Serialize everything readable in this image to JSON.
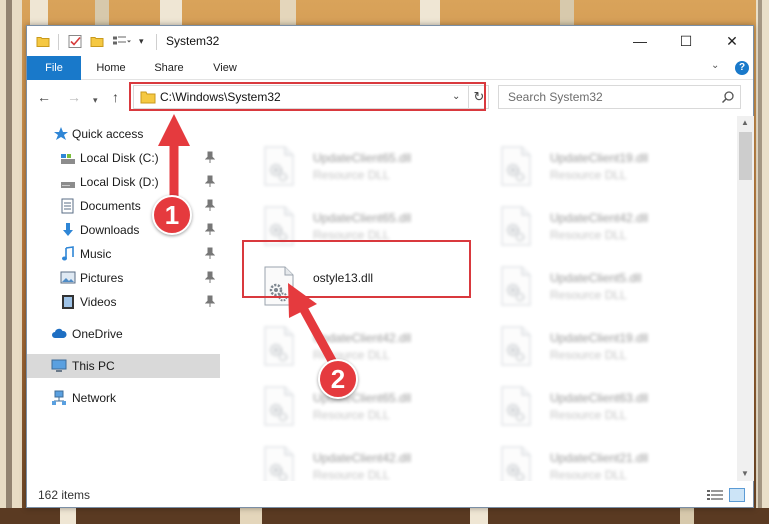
{
  "window": {
    "title": "System32",
    "minimize_glyph": "—",
    "maximize_glyph": "☐",
    "close_glyph": "✕"
  },
  "ribbon": {
    "tabs": [
      "File",
      "Home",
      "Share",
      "View"
    ],
    "help_glyph": "?"
  },
  "address": {
    "path": "C:\\Windows\\System32",
    "search_placeholder": "Search System32"
  },
  "nav_pane": {
    "items": [
      {
        "label": "Quick access",
        "icon": "star-icon"
      },
      {
        "label": "Local Disk (C:)",
        "icon": "drive-icon",
        "pinned": true
      },
      {
        "label": "Local Disk (D:)",
        "icon": "drive-icon",
        "pinned": true
      },
      {
        "label": "Documents",
        "icon": "documents-icon",
        "pinned": true
      },
      {
        "label": "Downloads",
        "icon": "downloads-icon",
        "pinned": true
      },
      {
        "label": "Music",
        "icon": "music-icon",
        "pinned": true
      },
      {
        "label": "Pictures",
        "icon": "pictures-icon",
        "pinned": true
      },
      {
        "label": "Videos",
        "icon": "videos-icon",
        "pinned": true
      },
      {
        "label": "OneDrive",
        "icon": "cloud-icon"
      },
      {
        "label": "This PC",
        "icon": "computer-icon",
        "selected": true
      },
      {
        "label": "Network",
        "icon": "network-icon"
      }
    ]
  },
  "files": [
    {
      "name": "UpdateClient65.dll",
      "desc": "Resource DLL",
      "blurred": true
    },
    {
      "name": "UpdateClient19.dll",
      "desc": "Resource DLL",
      "blurred": true
    },
    {
      "name": "UpdateClient65.dll",
      "desc": "Resource DLL",
      "blurred": true
    },
    {
      "name": "UpdateClient42.dll",
      "desc": "Resource DLL",
      "blurred": true
    },
    {
      "name": "ostyle13.dll",
      "desc": "",
      "blurred": false
    },
    {
      "name": "UpdateClient5.dll",
      "desc": "Resource DLL",
      "blurred": true
    },
    {
      "name": "UpdateClient42.dll",
      "desc": "Resource DLL",
      "blurred": true
    },
    {
      "name": "UpdateClient19.dll",
      "desc": "Resource DLL",
      "blurred": true
    },
    {
      "name": "UpdateClient65.dll",
      "desc": "Resource DLL",
      "blurred": true
    },
    {
      "name": "UpdateClient63.dll",
      "desc": "Resource DLL",
      "blurred": true
    },
    {
      "name": "UpdateClient42.dll",
      "desc": "Resource DLL",
      "blurred": true
    },
    {
      "name": "UpdateClient21.dll",
      "desc": "Resource DLL",
      "blurred": true
    }
  ],
  "status": {
    "item_count": "162 items"
  },
  "annotations": {
    "step1": "1",
    "step2": "2",
    "highlight_color": "#d9393e",
    "badge_color": "#e53a3e"
  },
  "colors": {
    "accent": "#1979ca",
    "selected_nav": "#d9d9d9"
  }
}
